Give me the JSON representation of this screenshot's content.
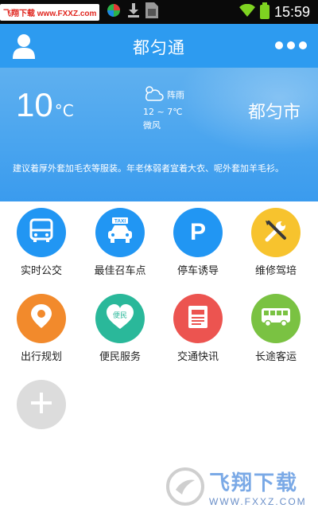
{
  "status_bar": {
    "site_badge": "飞翔下载 www.FXXZ.com",
    "time": "15:59",
    "icons": [
      "app-icon",
      "download-icon",
      "sim-icon",
      "wifi-icon",
      "battery-icon"
    ]
  },
  "app_bar": {
    "title": "都匀通",
    "icons": [
      "user-icon",
      "more-icon"
    ]
  },
  "weather": {
    "temperature": "10",
    "unit": "°C",
    "condition": "阵雨",
    "range": "12 ~ 7℃",
    "wind": "微风",
    "city": "都匀市",
    "advice": "建议着厚外套加毛衣等服装。年老体弱者宜着大衣、呢外套加羊毛衫。"
  },
  "services": [
    {
      "label": "实时公交",
      "color": "#2196f3",
      "icon": "bus-icon"
    },
    {
      "label": "最佳召车点",
      "color": "#2196f3",
      "icon": "taxi-icon"
    },
    {
      "label": "停车诱导",
      "color": "#2196f3",
      "icon": "parking-icon"
    },
    {
      "label": "维修驾培",
      "color": "#f7c32e",
      "icon": "tools-icon"
    },
    {
      "label": "出行规划",
      "color": "#f28a2c",
      "icon": "location-icon"
    },
    {
      "label": "便民服务",
      "color": "#2ab89a",
      "icon": "heart-icon"
    },
    {
      "label": "交通快讯",
      "color": "#ec5450",
      "icon": "news-icon"
    },
    {
      "label": "长途客运",
      "color": "#7ac242",
      "icon": "coach-icon"
    },
    {
      "label": "",
      "color": "#dcdcdc",
      "icon": "add-icon"
    }
  ],
  "icon_text": {
    "taxi": "TAXI",
    "parking": "P",
    "heart": "便民"
  },
  "watermark": {
    "cn": "飞翔下载",
    "url": "WWW.FXXZ.COM"
  }
}
